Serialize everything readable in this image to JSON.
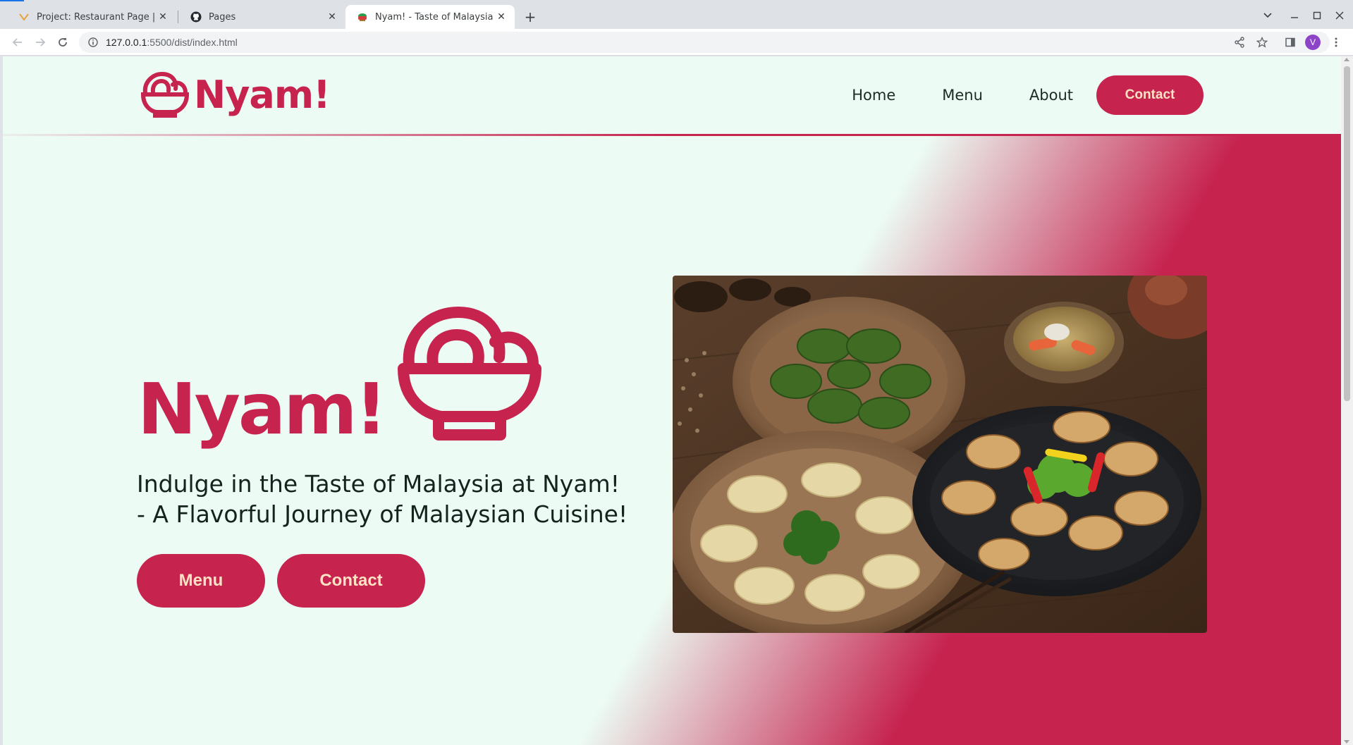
{
  "browser": {
    "tabs": [
      {
        "title": "Project: Restaurant Page | The",
        "active": false
      },
      {
        "title": "Pages",
        "active": false
      },
      {
        "title": "Nyam! - Taste of Malaysia",
        "active": true
      }
    ],
    "url_host": "127.0.0.1",
    "url_path": ":5500/dist/index.html",
    "profile_initial": "V"
  },
  "site": {
    "brand": "Nyam!",
    "nav": {
      "home": "Home",
      "menu": "Menu",
      "about": "About",
      "contact": "Contact"
    },
    "hero": {
      "title": "Nyam!",
      "subtitle": "Indulge in the Taste of Malaysia at Nyam! - A Flavorful Journey of Malaysian Cuisine!",
      "menu_button": "Menu",
      "contact_button": "Contact"
    },
    "colors": {
      "brand": "#c6234f",
      "background": "#ecfbf4",
      "button_text": "#fde3c4"
    }
  }
}
